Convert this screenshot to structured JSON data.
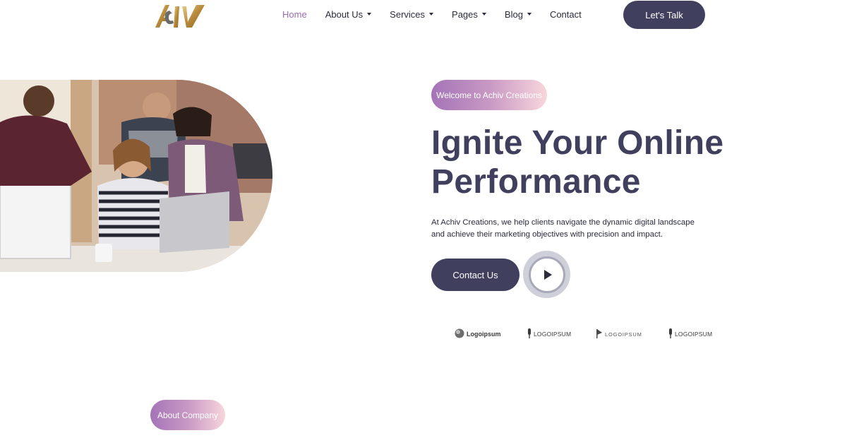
{
  "brand": {
    "logo_text": "Achiv"
  },
  "nav": {
    "items": [
      {
        "label": "Home",
        "active": true,
        "has_dropdown": false
      },
      {
        "label": "About Us",
        "active": false,
        "has_dropdown": true
      },
      {
        "label": "Services",
        "active": false,
        "has_dropdown": true
      },
      {
        "label": "Pages",
        "active": false,
        "has_dropdown": true
      },
      {
        "label": "Blog",
        "active": false,
        "has_dropdown": true
      },
      {
        "label": "Contact",
        "active": false,
        "has_dropdown": false
      }
    ]
  },
  "header": {
    "cta_label": "Let's Talk"
  },
  "hero": {
    "badge": "Welcome to Achiv Creations",
    "title_line1": "Ignite Your Online",
    "title_line2": "Performance",
    "description": "At Achiv Creations, we help clients navigate the dynamic digital landscape and achieve their marketing objectives with precision and impact.",
    "contact_label": "Contact Us",
    "image_icon": "team-photo"
  },
  "partners": [
    {
      "label": "Logoipsum",
      "icon": "circle-logo-icon"
    },
    {
      "label": "LOGOIPSUM",
      "icon": "pin-logo-icon"
    },
    {
      "label": "LOGOIPSUM",
      "icon": "flag-logo-icon"
    },
    {
      "label": "LOGOIPSUM",
      "icon": "pin-logo-icon"
    }
  ],
  "about": {
    "badge": "About Company"
  },
  "colors": {
    "primary": "#403f5e",
    "accent": "#9b6bb4",
    "gradient_start": "#a474b8",
    "gradient_end": "#f8d6dc",
    "logo_gold": "#c9a25a"
  }
}
